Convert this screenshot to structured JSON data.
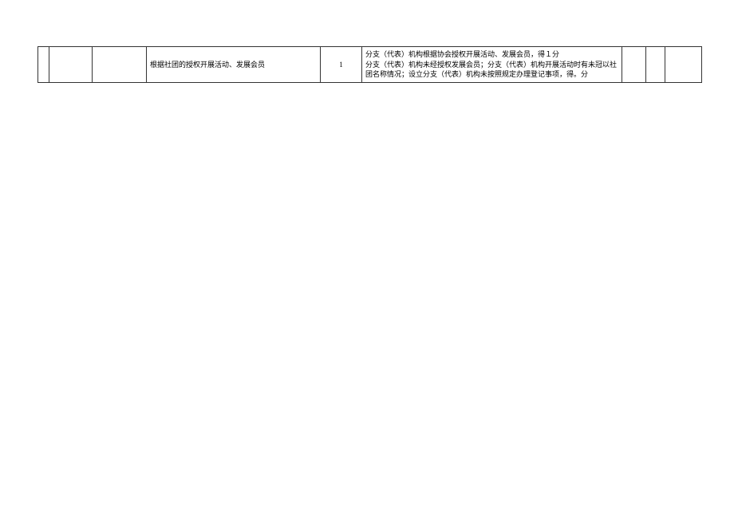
{
  "table": {
    "rows": [
      {
        "c1": "",
        "c2": "",
        "c3": "",
        "c4": "根据社团的授权开展活动、发展会员",
        "c5": "1",
        "c6": "分支（代表）机构根据协会授权开展活动、发展会员，得１分\n分支（代表）机构未经授权发展会员；分支（代表）机构开展活动时有未冠以社团名称情况；设立分支（代表）机构未按照规定办理登记事项，得。分",
        "c7": "",
        "c8": "",
        "c9": ""
      }
    ]
  }
}
